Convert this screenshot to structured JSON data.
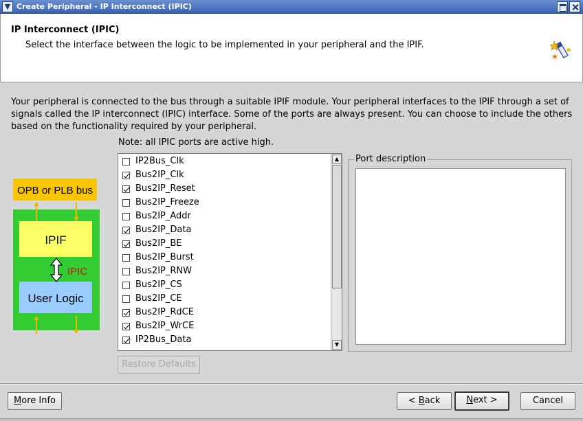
{
  "window": {
    "title": "Create Peripheral - IP Interconnect (IPIC)"
  },
  "header": {
    "heading": "IP Interconnect (IPIC)",
    "subtitle": "Select the interface between the logic to be implemented in your peripheral and the IPIF.",
    "icon": "wizard-icon"
  },
  "description": {
    "line1": "Your peripheral is connected to the bus through a suitable IPIF module. Your peripheral interfaces to the IPIF through a set of",
    "line2": "signals called the IP interconnect (IPIC) interface. Some of the ports are always present. You can choose to include the others",
    "line3": "based on the functionality required by your peripheral."
  },
  "note": "Note: all IPIC ports are active high.",
  "diagram": {
    "bus_label": "OPB or PLB bus",
    "ipif_label": "IPIF",
    "ipic_label": "IPIC",
    "user_logic_label": "User Logic",
    "colors": {
      "bus": "#f7c600",
      "outer": "#33cc33",
      "ipif": "#ffff66",
      "user_logic": "#99ccff",
      "ipic_text": "#b22222"
    }
  },
  "ports": [
    {
      "name": "IP2Bus_Clk",
      "checked": false
    },
    {
      "name": "Bus2IP_Clk",
      "checked": true
    },
    {
      "name": "Bus2IP_Reset",
      "checked": true
    },
    {
      "name": "Bus2IP_Freeze",
      "checked": false
    },
    {
      "name": "Bus2IP_Addr",
      "checked": false
    },
    {
      "name": "Bus2IP_Data",
      "checked": true
    },
    {
      "name": "Bus2IP_BE",
      "checked": true
    },
    {
      "name": "Bus2IP_Burst",
      "checked": false
    },
    {
      "name": "Bus2IP_RNW",
      "checked": false
    },
    {
      "name": "Bus2IP_CS",
      "checked": false
    },
    {
      "name": "Bus2IP_CE",
      "checked": false
    },
    {
      "name": "Bus2IP_RdCE",
      "checked": true
    },
    {
      "name": "Bus2IP_WrCE",
      "checked": true
    },
    {
      "name": "IP2Bus_Data",
      "checked": true
    }
  ],
  "port_description": {
    "legend": "Port description",
    "text": ""
  },
  "buttons": {
    "restore_defaults": "Restore Defaults",
    "more_info_prefix": "",
    "more_info_mnemonic": "M",
    "more_info_suffix": "ore Info",
    "back_prefix": "< ",
    "back_mnemonic": "B",
    "back_suffix": "ack",
    "next_prefix": "",
    "next_mnemonic": "N",
    "next_suffix": "ext >",
    "cancel": "Cancel"
  }
}
